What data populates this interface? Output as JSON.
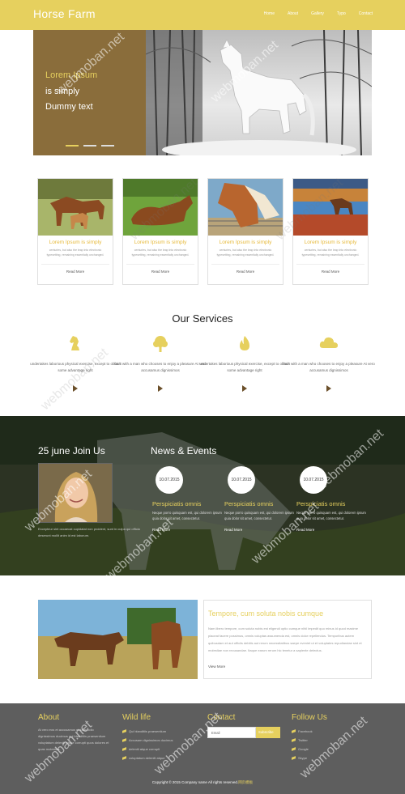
{
  "header": {
    "logo": "Horse Farm",
    "nav": [
      "Home",
      "About",
      "Gallery",
      "Typo",
      "Contact"
    ]
  },
  "hero": {
    "line1": "Lorem Ipsum",
    "line2": "is simply",
    "line3": "Dummy text"
  },
  "cards": [
    {
      "title": "Lorem Ipsum is simply",
      "text": "centuries, but also the leap into electronic typesetting, remaining essentially unchanged.",
      "more": "Read More"
    },
    {
      "title": "Lorem Ipsum is simply",
      "text": "centuries, but also the leap into electronic typesetting, remaining essentially unchanged.",
      "more": "Read More"
    },
    {
      "title": "Lorem Ipsum is simply",
      "text": "centuries, but also the leap into electronic typesetting, remaining essentially unchanged.",
      "more": "Read More"
    },
    {
      "title": "Lorem Ipsum is simply",
      "text": "centuries, but also the leap into electronic typesetting, remaining essentially unchanged.",
      "more": "Read More"
    }
  ],
  "services": {
    "title": "Our Services",
    "items": [
      {
        "icon": "chess-knight-icon",
        "text": "undertakes laborious physical exercise, except to obtain some advantage right"
      },
      {
        "icon": "tree-icon",
        "text": "fault with a man who chooses to enjoy a pleasure At vero accusamus dignissimos"
      },
      {
        "icon": "fire-icon",
        "text": "undertakes laborious physical exercise, except to obtain some advantage right"
      },
      {
        "icon": "cloud-icon",
        "text": "fault with a man who chooses to enjoy a pleasure At vero accusamus dignissimos"
      }
    ]
  },
  "join": {
    "title": "25 june Join Us",
    "text": "Excepteur sint occaecat cupidatat non proident, sunt in culpa qui officia deserunt mollit anim id est laborum."
  },
  "news": {
    "title": "News & Events",
    "events": [
      {
        "date": "10.07.2015",
        "title": "Perspiciatis omnis",
        "text": "Neque porro quisquam est, qui dolorem ipsum quia dolor sit amet, consectetur.",
        "more": "Read More"
      },
      {
        "date": "10.07.2015",
        "title": "Perspiciatis omnis",
        "text": "Neque porro quisquam est, qui dolorem ipsum quia dolor sit amet, consectetur.",
        "more": "Read More"
      },
      {
        "date": "10.07.2015",
        "title": "Perspiciatis omnis",
        "text": "Neque porro quisquam est, qui dolorem ipsum quia dolor sit amet, consectetur.",
        "more": "Read More"
      }
    ]
  },
  "feature": {
    "title": "Tempore, cum soluta nobis cumque",
    "text": "Nam libero tempore, cum soluta nobis est eligendi optio cumque nihil impedit quo minus id quod maxime placeat facere possimus, omnis voluptas assumenda est, omnis dolor repellendus. Temporibus autem quibusdam et aut officiis debitis aut rerum necessitatibus saepe eveniet ut et voluptates repudiandae sint et molestiae non recusandae. Itaque earum rerum hic tenetur a sapiente delectus.",
    "more": "View More"
  },
  "footer": {
    "about_title": "About",
    "about_text": "At vero eos et accusamus et iusto odio dignissimos ducimus qui blanditiis praesentium voluptatum deleniti atque corrupti quos dolores et quas molestias.",
    "wild_title": "Wild life",
    "wild_items": [
      "Qui blanditiis praesentium",
      "Accusam dignissimos ducimus",
      "deleniti atque corrupti",
      "voluptatum deleniti atque"
    ],
    "contact_title": "Contact",
    "email_placeholder": "Email",
    "subscribe": "Subscribe",
    "follow_title": "Follow Us",
    "follow_items": [
      "Facebook",
      "Twitter",
      "Google",
      "Skype"
    ],
    "copyright": "Copyright © 2015 Company name All rights reserved.",
    "copyright_cn": "网页模板"
  },
  "watermark": "webmoban.net",
  "colors": {
    "accent": "#e6d05e",
    "brown": "#8a6d3b",
    "footer": "#5e5e5e"
  }
}
